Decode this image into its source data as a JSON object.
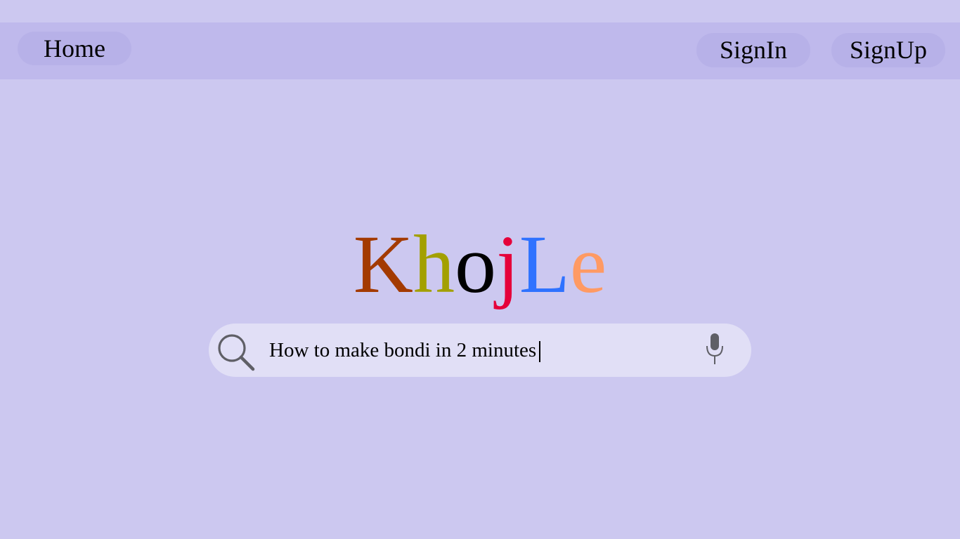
{
  "nav": {
    "home_label": "Home",
    "signin_label": "SignIn",
    "signup_label": "SignUp"
  },
  "logo": {
    "letters": [
      {
        "char": "K",
        "color": "#a33a00"
      },
      {
        "char": "h",
        "color": "#a3a000"
      },
      {
        "char": "o",
        "color": "#000000"
      },
      {
        "char": "j",
        "color": "#e5003a"
      },
      {
        "char": "L",
        "color": "#2f72ff"
      },
      {
        "char": "e",
        "color": "#ff9a64"
      }
    ]
  },
  "search": {
    "value": "How to make bondi in 2 minutes",
    "left_icon": "search-icon",
    "right_icon": "microphone-icon"
  },
  "colors": {
    "background": "#ccc8f0",
    "topbar": "#bfb9ec",
    "pill": "#b7b1e8",
    "search_bg": "#e1dff6",
    "icon_gray": "#5f5f66"
  }
}
